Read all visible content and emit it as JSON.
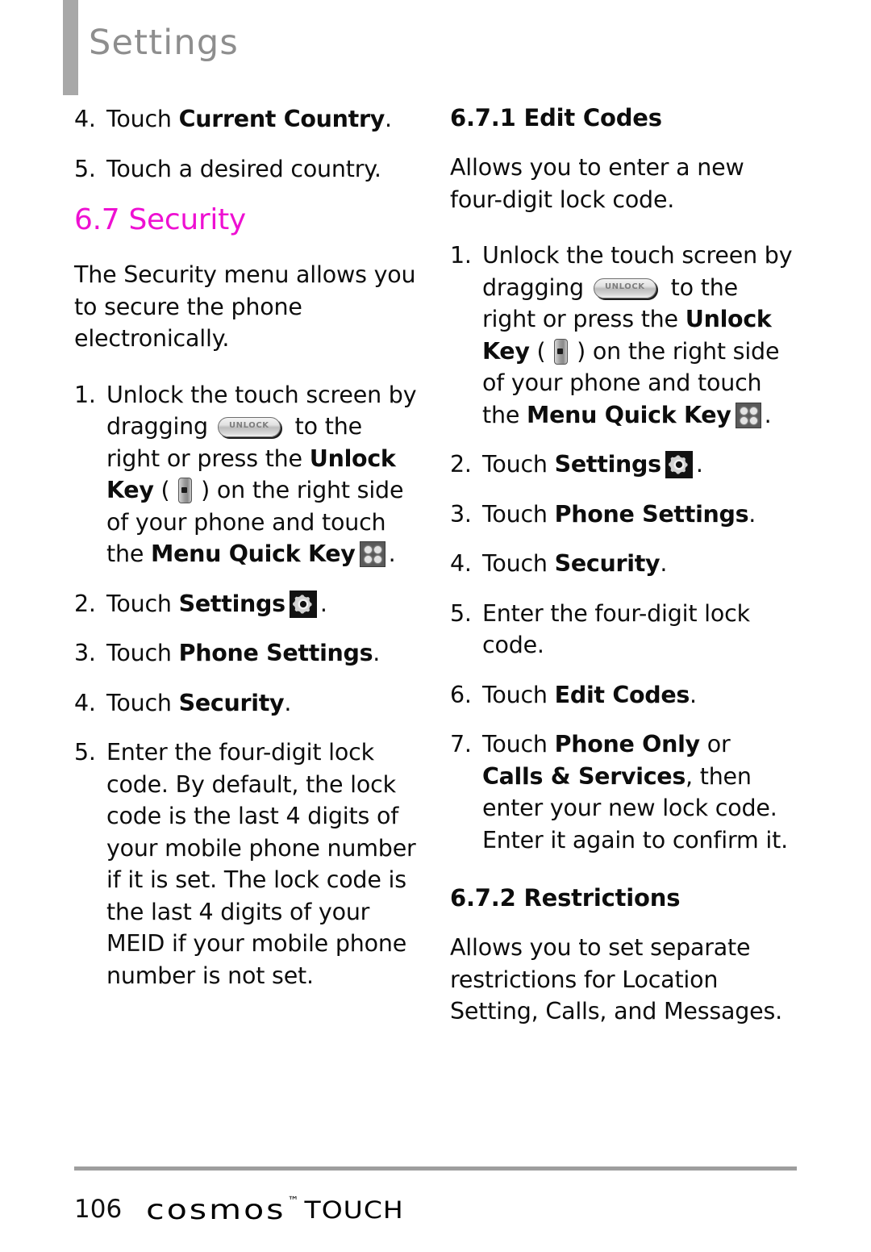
{
  "header": {
    "title": "Settings",
    "bar_color": "#a8a8a8",
    "title_color": "#8e8e8e"
  },
  "accent_color": "#ee10d2",
  "icons": {
    "unlock_pill_label": "UNLOCK",
    "unlock_key": "unlock-key-icon",
    "menu_quick_key": "menu-quick-key-icon",
    "settings_gear": "settings-gear-icon"
  },
  "left_column": {
    "step4_country": {
      "num": "4.",
      "pre": "Touch ",
      "bold": "Current Country",
      "post": "."
    },
    "step5_country": {
      "num": "5.",
      "text": "Touch a desired country."
    },
    "section_heading": "6.7 Security",
    "intro": "The Security menu allows you to secure the phone electronically.",
    "step1": {
      "num": "1.",
      "t1": "Unlock the touch screen by dragging ",
      "t2": " to the right or press the ",
      "b1": "Unlock Key",
      "t3": " ( ",
      "t4": " ) on the right side of your phone and touch the ",
      "b2": "Menu Quick Key",
      "t5": "."
    },
    "step2": {
      "num": "2.",
      "pre": "Touch ",
      "bold": "Settings",
      "post": "."
    },
    "step3": {
      "num": "3.",
      "pre": "Touch ",
      "bold": "Phone Settings",
      "post": "."
    },
    "step4": {
      "num": "4.",
      "pre": "Touch ",
      "bold": "Security",
      "post": "."
    },
    "step5": {
      "num": "5.",
      "text": "Enter the four-digit lock code. By default, the lock code is the last 4 digits of your mobile phone number if it is set. The lock code is the last 4 digits of your MEID if your mobile phone number is not set."
    }
  },
  "right_column": {
    "subheading_1": "6.7.1 Edit Codes",
    "desc_1": "Allows you to enter a new four-digit lock code.",
    "step1": {
      "num": "1.",
      "t1": "Unlock the touch screen by dragging ",
      "t2": " to the right or press the ",
      "b1": "Unlock Key",
      "t3": " ( ",
      "t4": " ) on the right side of your phone and touch the ",
      "b2": "Menu Quick Key",
      "t5": "."
    },
    "step2": {
      "num": "2.",
      "pre": "Touch ",
      "bold": "Settings",
      "post": "."
    },
    "step3": {
      "num": "3.",
      "pre": "Touch ",
      "bold": "Phone Settings",
      "post": "."
    },
    "step4": {
      "num": "4.",
      "pre": "Touch ",
      "bold": "Security",
      "post": "."
    },
    "step5": {
      "num": "5.",
      "text": "Enter the four-digit lock code."
    },
    "step6": {
      "num": "6.",
      "pre": "Touch ",
      "bold": "Edit Codes",
      "post": "."
    },
    "step7": {
      "num": "7.",
      "t1": "Touch ",
      "b1": "Phone Only",
      "t2": " or ",
      "b2": "Calls & Services",
      "t3": ", then enter your new lock code. Enter it again to confirm it."
    },
    "subheading_2": "6.7.2 Restrictions",
    "desc_2": "Allows you to set separate restrictions for Location Setting, Calls, and Messages."
  },
  "footer": {
    "page_number": "106",
    "brand": "cosmos",
    "trademark": "™",
    "brand_suffix": "TOUCH"
  }
}
